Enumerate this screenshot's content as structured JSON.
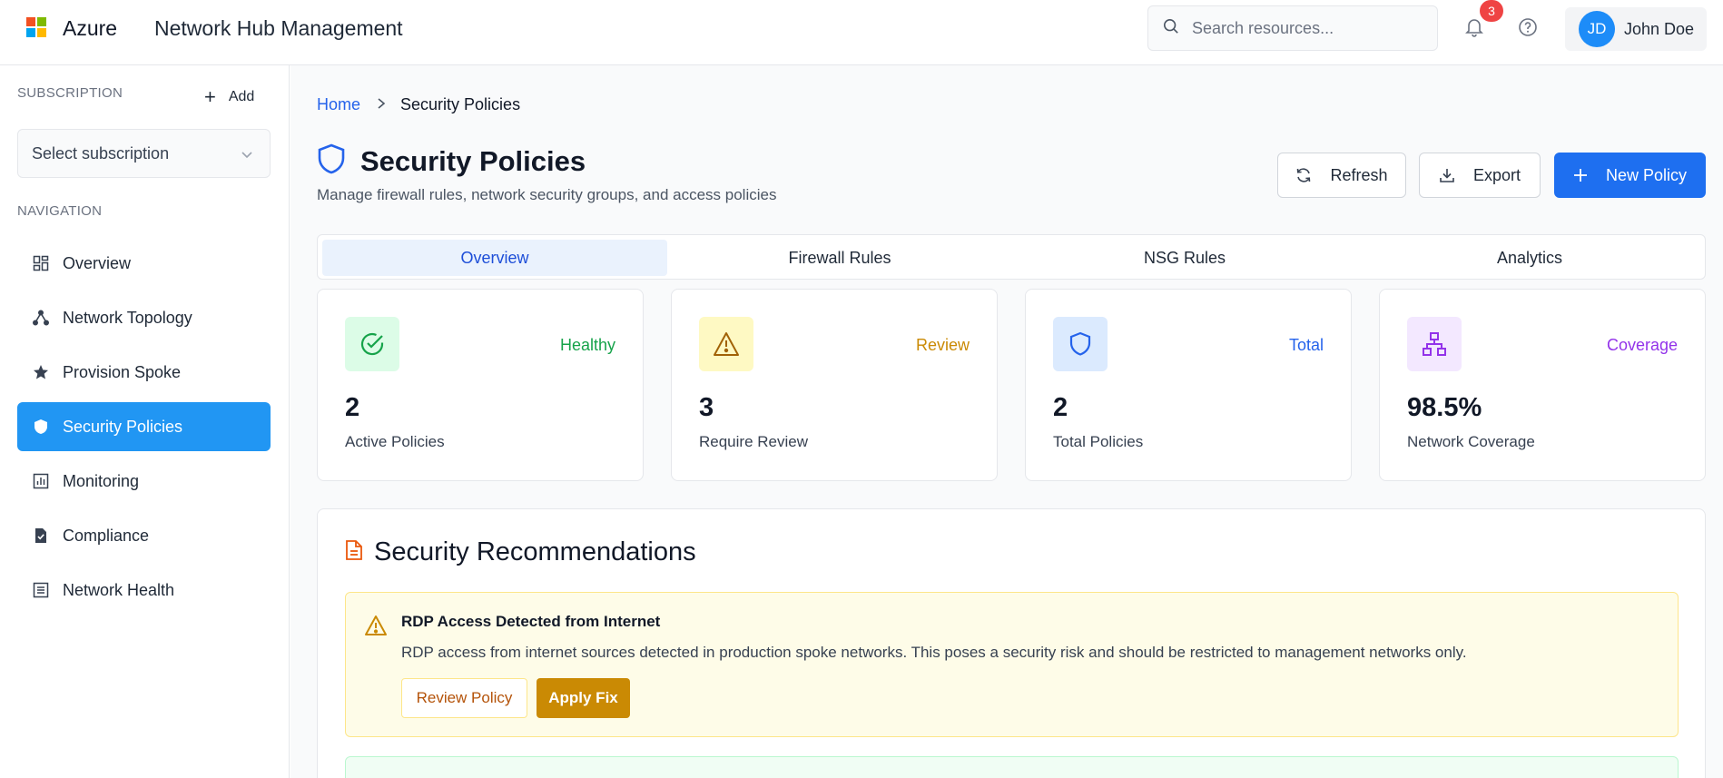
{
  "header": {
    "brand": "Azure",
    "app_title": "Network Hub Management",
    "search_placeholder": "Search resources...",
    "notification_count": "3",
    "user_initials": "JD",
    "user_name": "John Doe"
  },
  "sidebar": {
    "subscription_label": "SUBSCRIPTION",
    "add_label": "Add",
    "select_placeholder": "Select subscription",
    "navigation_label": "NAVIGATION",
    "items": [
      {
        "label": "Overview",
        "icon": "dashboard-icon"
      },
      {
        "label": "Network Topology",
        "icon": "topology-icon"
      },
      {
        "label": "Provision Spoke",
        "icon": "star-icon"
      },
      {
        "label": "Security Policies",
        "icon": "shield-icon",
        "active": true
      },
      {
        "label": "Monitoring",
        "icon": "chart-icon"
      },
      {
        "label": "Compliance",
        "icon": "checklist-icon"
      },
      {
        "label": "Network Health",
        "icon": "list-icon"
      }
    ]
  },
  "breadcrumb": {
    "home": "Home",
    "current": "Security Policies"
  },
  "page": {
    "title": "Security Policies",
    "subtitle": "Manage firewall rules, network security groups, and access policies",
    "refresh_label": "Refresh",
    "export_label": "Export",
    "new_policy_label": "New Policy"
  },
  "tabs": [
    {
      "label": "Overview",
      "active": true
    },
    {
      "label": "Firewall Rules"
    },
    {
      "label": "NSG Rules"
    },
    {
      "label": "Analytics"
    }
  ],
  "stats": [
    {
      "tag": "Healthy",
      "value": "2",
      "label": "Active Policies",
      "color": "#16a34a",
      "bg": "#dcfce7",
      "icon": "check-circle-icon"
    },
    {
      "tag": "Review",
      "value": "3",
      "label": "Require Review",
      "color": "#ca8a04",
      "bg": "#fef9c3",
      "icon": "warning-icon"
    },
    {
      "tag": "Total",
      "value": "2",
      "label": "Total Policies",
      "color": "#2563eb",
      "bg": "#dbeafe",
      "icon": "shield-icon"
    },
    {
      "tag": "Coverage",
      "value": "98.5%",
      "label": "Network Coverage",
      "color": "#9333ea",
      "bg": "#f3e8ff",
      "icon": "network-icon"
    }
  ],
  "recommendations": {
    "title": "Security Recommendations",
    "alert_title": "RDP Access Detected from Internet",
    "alert_desc": "RDP access from internet sources detected in production spoke networks. This poses a security risk and should be restricted to management networks only.",
    "review_label": "Review Policy",
    "fix_label": "Apply Fix"
  },
  "colors": {
    "accent": "#1e6ff0",
    "active_nav": "#2196f3"
  }
}
